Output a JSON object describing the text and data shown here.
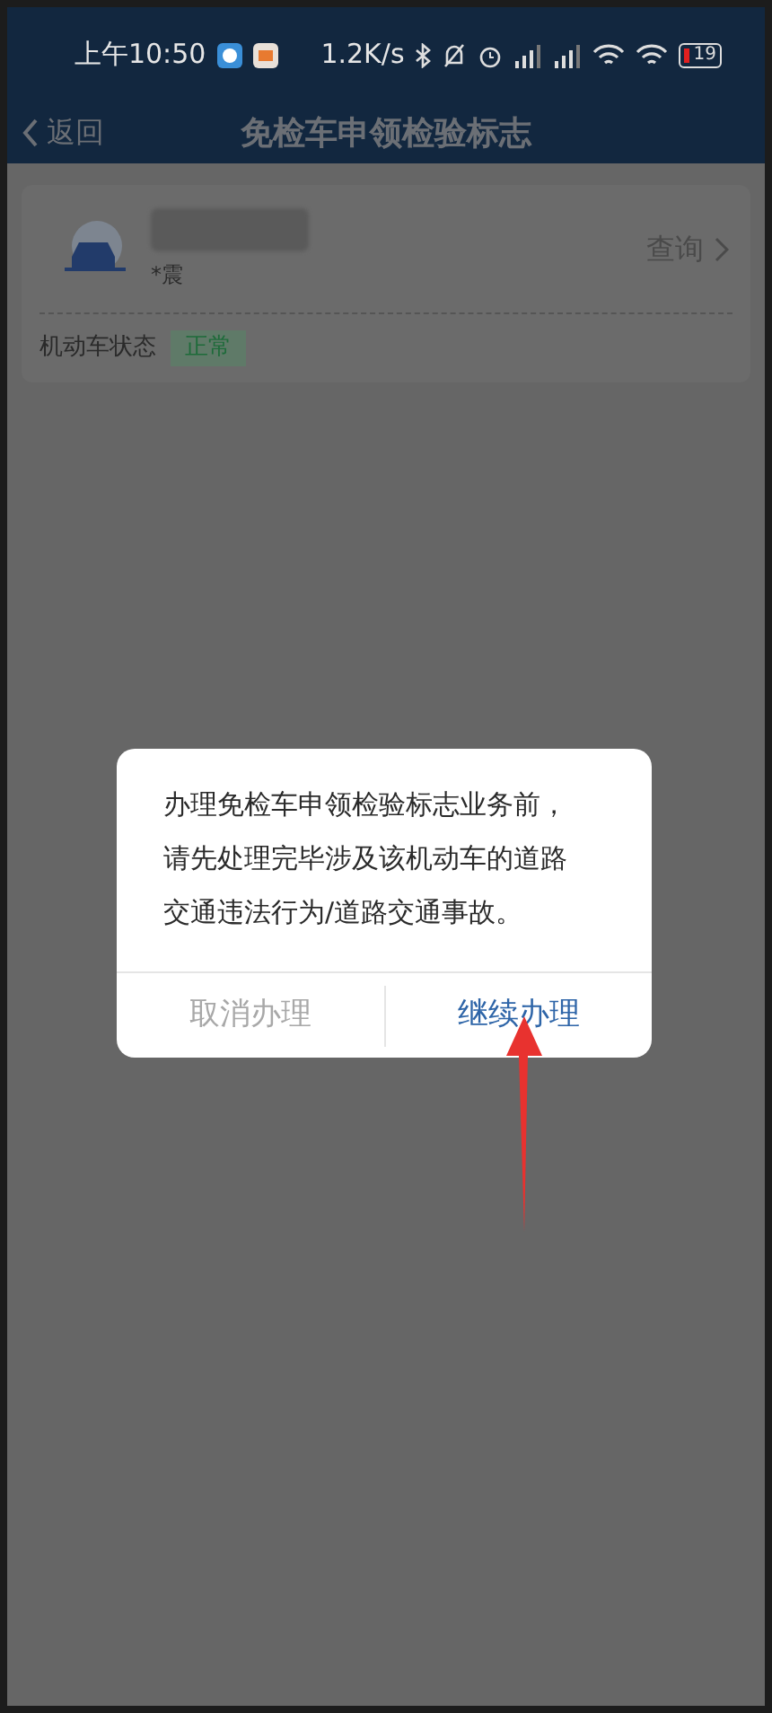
{
  "status_bar": {
    "time": "上午10:50",
    "speed": "1.2K/s",
    "battery": "19"
  },
  "header": {
    "back": "返回",
    "title": "免检车申领检验标志"
  },
  "vehicle_card": {
    "plate_suffix": "*震",
    "action": "查询",
    "status_label": "机动车状态",
    "status_badge": "正常"
  },
  "dialog": {
    "message": "办理免检车申领检验标志业务前，请先处理完毕涉及该机动车的道路交通违法行为/道路交通事故。",
    "buttons": [
      {
        "label": "取消办理",
        "kind": "secondary"
      },
      {
        "label": "继续办理",
        "kind": "primary"
      }
    ]
  }
}
